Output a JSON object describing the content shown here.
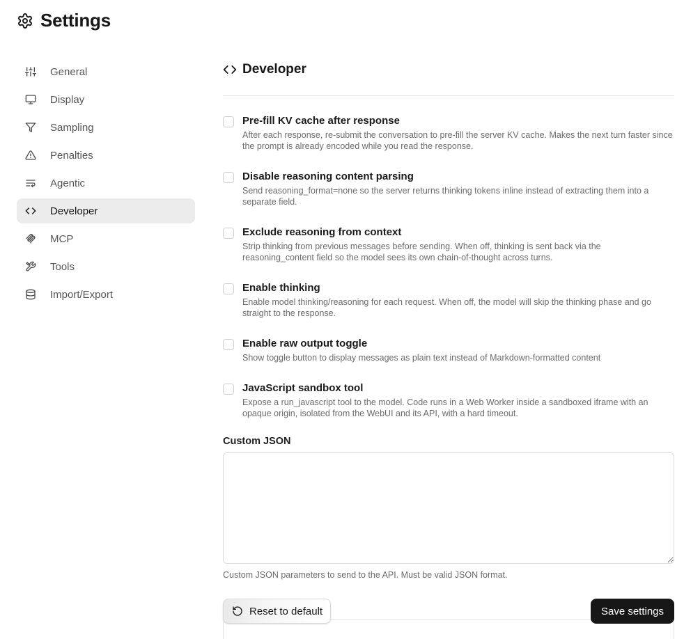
{
  "app": {
    "title": "Settings",
    "icon": "gear-icon"
  },
  "sidebar": {
    "items": [
      {
        "label": "General",
        "icon": "sliders-icon",
        "active": false
      },
      {
        "label": "Display",
        "icon": "monitor-icon",
        "active": false
      },
      {
        "label": "Sampling",
        "icon": "funnel-icon",
        "active": false
      },
      {
        "label": "Penalties",
        "icon": "warning-triangle-icon",
        "active": false
      },
      {
        "label": "Agentic",
        "icon": "list-wrap-icon",
        "active": false
      },
      {
        "label": "Developer",
        "icon": "code-icon",
        "active": true
      },
      {
        "label": "MCP",
        "icon": "mcp-icon",
        "active": false
      },
      {
        "label": "Tools",
        "icon": "tools-icon",
        "active": false
      },
      {
        "label": "Import/Export",
        "icon": "database-icon",
        "active": false
      }
    ]
  },
  "section": {
    "title": "Developer",
    "icon": "code-icon"
  },
  "options": [
    {
      "title": "Pre-fill KV cache after response",
      "description": "After each response, re-submit the conversation to pre-fill the server KV cache. Makes the next turn faster since the prompt is already encoded while you read the response.",
      "checked": false
    },
    {
      "title": "Disable reasoning content parsing",
      "description": "Send reasoning_format=none so the server returns thinking tokens inline instead of extracting them into a separate field.",
      "checked": false
    },
    {
      "title": "Exclude reasoning from context",
      "description": "Strip thinking from previous messages before sending. When off, thinking is sent back via the reasoning_content field so the model sees its own chain-of-thought across turns.",
      "checked": false
    },
    {
      "title": "Enable thinking",
      "description": "Enable model thinking/reasoning for each request. When off, the model will skip the thinking phase and go straight to the response.",
      "checked": false
    },
    {
      "title": "Enable raw output toggle",
      "description": "Show toggle button to display messages as plain text instead of Markdown-formatted content",
      "checked": false
    },
    {
      "title": "JavaScript sandbox tool",
      "description": "Expose a run_javascript tool to the model. Code runs in a Web Worker inside a sandboxed iframe with an opaque origin, isolated from the WebUI and its API, with a hard timeout.",
      "checked": false
    }
  ],
  "custom_json": {
    "label": "Custom JSON",
    "value": "",
    "help": "Custom JSON parameters to send to the API. Must be valid JSON format."
  },
  "footer": {
    "reset_label": "Reset to default",
    "save_label": "Save settings"
  }
}
